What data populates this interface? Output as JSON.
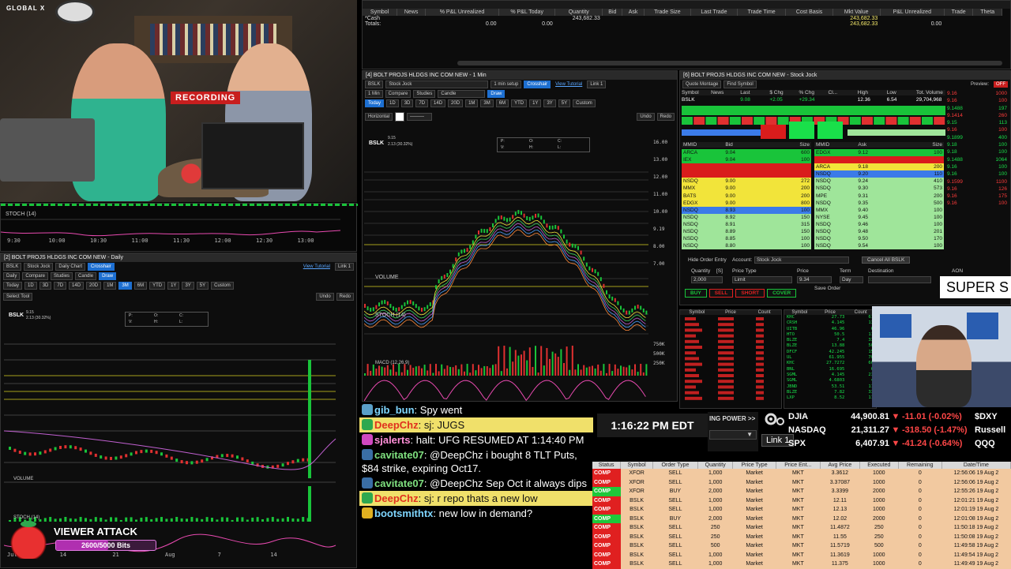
{
  "broadcast": {
    "logo": "GLOBAL X",
    "recording_label": "RECORDING",
    "super_text": "SUPER S",
    "clock": "1:16:22 PM EDT",
    "viewer_attack": {
      "title": "VIEWER ATTACK",
      "progress_text": "2600/5000 Bits",
      "progress": 0.52
    }
  },
  "positions": {
    "columns": [
      "Symbol",
      "News",
      "% P&L Unrealized",
      "% P&L Today",
      "Quantity",
      "Bid",
      "Ask",
      "Trade Size",
      "Last Trade",
      "Trade Time",
      "Cost Basis",
      "Mkt Value",
      "P&L Unrealized",
      "Trade",
      "Theta"
    ],
    "rows": [
      {
        "symbol": "*Cash",
        "quantity": "243,682.33",
        "mkt_value": "243,682.33"
      },
      {
        "symbol": "Totals:",
        "pnl_unreal_pct": "0.00",
        "pnl_today_pct": "0.00",
        "mkt_value": "243,682.33",
        "pnl_unreal": "0.00"
      }
    ]
  },
  "chart_intraday": {
    "title": "[4] BOLT PROJS HLDGS INC COM NEW - 1 Min",
    "symbol": "BSLK",
    "layout": "Stock Jock",
    "setup": "1 min setup",
    "crosshair": "Crosshair",
    "view_tutorial": "View Tutorial",
    "link": "Link 1",
    "interval": "1 Min",
    "compare": "Compare",
    "studies": "Studies",
    "style": "Candle",
    "draw": "Draw",
    "ranges": [
      "Today",
      "1D",
      "3D",
      "7D",
      "14D",
      "20D",
      "1M",
      "3M",
      "6M",
      "YTD",
      "1Y",
      "3Y",
      "5Y",
      "Custom"
    ],
    "active_range": "Today",
    "line_tool": "Horizontal",
    "undo": "Undo",
    "redo": "Redo",
    "quote": "BSLK",
    "price_time": "9.15",
    "change": "2.13 (30.32%)",
    "ohlc_labels": [
      "P:",
      "O:",
      "C:",
      "V:",
      "H:",
      "L:"
    ],
    "panes": [
      "VOLUME",
      "STOCH (14)",
      "MACD (12,26,9)"
    ],
    "price_ticks": [
      "16.00",
      "13.00",
      "12.00",
      "11.00",
      "10.00",
      "9.19",
      "8.00",
      "7.00"
    ],
    "vol_ticks": [
      "750K",
      "500K",
      "250K"
    ],
    "stoch_ticks": [
      "80",
      "50",
      "20"
    ]
  },
  "chart_daily": {
    "title": "[2] BOLT PROJS HLDGS INC COM NEW - Daily",
    "symbol": "BSLK",
    "layout": "Stock Jock",
    "chart_type": "Daily Chart",
    "crosshair": "Crosshair",
    "view_tutorial": "View Tutorial",
    "link": "Link 1",
    "interval": "Daily",
    "compare": "Compare",
    "studies": "Studies",
    "style": "Candle",
    "draw": "Draw",
    "ranges": [
      "Today",
      "1D",
      "3D",
      "7D",
      "14D",
      "20D",
      "1M",
      "3M",
      "6M",
      "YTD",
      "1Y",
      "3Y",
      "5Y",
      "Custom"
    ],
    "active_range": "3M",
    "select_tool": "Select Tool",
    "undo": "Undo",
    "redo": "Redo",
    "quote": "BSLK",
    "price_time": "9.15",
    "change": "2.13 (30.32%)",
    "ohlc_labels": [
      "P:",
      "O:",
      "C:",
      "V:",
      "H:",
      "L:"
    ],
    "panes": [
      "VOLUME",
      "STOCH (14)"
    ],
    "x_ticks": [
      "Jul",
      "14",
      "21",
      "Aug",
      "7",
      "14"
    ]
  },
  "stoch_top": {
    "label": "STOCH (14)",
    "x_ticks": [
      "9:30",
      "10:00",
      "10:30",
      "11:00",
      "11:30",
      "12:00",
      "12:30",
      "13:00"
    ]
  },
  "level2": {
    "title": "[6] BOLT PROJS HLDGS INC COM NEW - Stock Jock",
    "view": "Quote Montage",
    "find_symbol": "Find Symbol",
    "preview": "Preview:",
    "preview_state": "OFF",
    "quote_headers": [
      "Symbol",
      "News",
      "Last",
      "$ Chg",
      "% Chg",
      "Cl...",
      "High",
      "Low",
      "Tot. Volume"
    ],
    "quote": {
      "symbol": "BSLK",
      "last": "9.08",
      "chg": "+2.05",
      "pct": "+29.34",
      "high": "12.36",
      "low": "6.54",
      "volume": "29,704,968"
    },
    "bid_headers": [
      "MMID",
      "Bid",
      "Size"
    ],
    "ask_headers": [
      "MMID",
      "Ask",
      "Size"
    ],
    "bids": [
      {
        "mm": "ARCA",
        "px": "9.04",
        "sz": "600",
        "c": "#19c43a"
      },
      {
        "mm": "IEX",
        "px": "9.04",
        "sz": "100",
        "c": "#19c43a"
      },
      {
        "mm": "",
        "px": "",
        "sz": "",
        "c": "#d91c1c"
      },
      {
        "mm": "",
        "px": "",
        "sz": "",
        "c": "#d91c1c"
      },
      {
        "mm": "NSDQ",
        "px": "9.00",
        "sz": "272",
        "c": "#f2e43a"
      },
      {
        "mm": "MMX",
        "px": "9.00",
        "sz": "200",
        "c": "#f2e43a"
      },
      {
        "mm": "BATS",
        "px": "9.00",
        "sz": "200",
        "c": "#f2e43a"
      },
      {
        "mm": "EDGX",
        "px": "9.00",
        "sz": "800",
        "c": "#f2e43a"
      },
      {
        "mm": "NSDQ",
        "px": "8.93",
        "sz": "100",
        "c": "#3b7be8"
      },
      {
        "mm": "NSDQ",
        "px": "8.92",
        "sz": "150",
        "c": "#9fe59a"
      },
      {
        "mm": "NSDQ",
        "px": "8.91",
        "sz": "315",
        "c": "#9fe59a"
      },
      {
        "mm": "NSDQ",
        "px": "8.89",
        "sz": "150",
        "c": "#9fe59a"
      },
      {
        "mm": "NSDQ",
        "px": "8.85",
        "sz": "100",
        "c": "#9fe59a"
      },
      {
        "mm": "NSDQ",
        "px": "8.80",
        "sz": "100",
        "c": "#9fe59a"
      }
    ],
    "asks": [
      {
        "mm": "EDGX",
        "px": "9.12",
        "sz": "100",
        "c": "#19c43a"
      },
      {
        "mm": "",
        "px": "",
        "sz": "",
        "c": "#d91c1c"
      },
      {
        "mm": "ARCA",
        "px": "9.18",
        "sz": "200",
        "c": "#f2e43a"
      },
      {
        "mm": "NSDQ",
        "px": "9.20",
        "sz": "110",
        "c": "#3b7be8"
      },
      {
        "mm": "NSDQ",
        "px": "9.24",
        "sz": "410",
        "c": "#9fe59a"
      },
      {
        "mm": "NSDQ",
        "px": "9.30",
        "sz": "573",
        "c": "#9fe59a"
      },
      {
        "mm": "MPE",
        "px": "9.31",
        "sz": "200",
        "c": "#9fe59a"
      },
      {
        "mm": "NSDQ",
        "px": "9.35",
        "sz": "500",
        "c": "#9fe59a"
      },
      {
        "mm": "MMX",
        "px": "9.40",
        "sz": "100",
        "c": "#9fe59a"
      },
      {
        "mm": "NYSE",
        "px": "9.45",
        "sz": "100",
        "c": "#9fe59a"
      },
      {
        "mm": "NSDQ",
        "px": "9.46",
        "sz": "100",
        "c": "#9fe59a"
      },
      {
        "mm": "NSDQ",
        "px": "9.48",
        "sz": "201",
        "c": "#9fe59a"
      },
      {
        "mm": "NSDQ",
        "px": "9.50",
        "sz": "170",
        "c": "#9fe59a"
      },
      {
        "mm": "NSDQ",
        "px": "9.54",
        "sz": "100",
        "c": "#9fe59a"
      }
    ],
    "time_sales": [
      {
        "p": "9.16",
        "s": "1000",
        "c": "#ff3b3b"
      },
      {
        "p": "9.16",
        "s": "100",
        "c": "#ff3b3b"
      },
      {
        "p": "9.1488",
        "s": "197",
        "c": "#19e04a"
      },
      {
        "p": "9.1414",
        "s": "260",
        "c": "#ff3b3b"
      },
      {
        "p": "9.15",
        "s": "113",
        "c": "#19e04a"
      },
      {
        "p": "9.16",
        "s": "100",
        "c": "#ff3b3b"
      },
      {
        "p": "9.1899",
        "s": "400",
        "c": "#19e04a"
      },
      {
        "p": "9.18",
        "s": "100",
        "c": "#19e04a"
      },
      {
        "p": "9.18",
        "s": "100",
        "c": "#19e04a"
      },
      {
        "p": "9.1488",
        "s": "1064",
        "c": "#19e04a"
      },
      {
        "p": "9.16",
        "s": "100",
        "c": "#19e04a"
      },
      {
        "p": "9.16",
        "s": "100",
        "c": "#19e04a"
      },
      {
        "p": "9.1599",
        "s": "1100",
        "c": "#ff3b3b"
      },
      {
        "p": "9.16",
        "s": "126",
        "c": "#ff3b3b"
      },
      {
        "p": "9.16",
        "s": "175",
        "c": "#ff3b3b"
      },
      {
        "p": "9.16",
        "s": "100",
        "c": "#ff3b3b"
      }
    ],
    "order": {
      "hide_order_entry": "Hide Order Entry",
      "account_label": "Account:",
      "account": "Stock Jock",
      "cancel_all": "Cancel All BSLK",
      "qty_label": "Quantity",
      "qty_unit": "[S]",
      "price_type_label": "Price Type",
      "price_label": "Price",
      "term_label": "Term",
      "destination_label": "Destination",
      "aon": "AON",
      "qty": "2,000",
      "price_type": "Limit",
      "price": "9.34",
      "term": "Day",
      "save_order": "Save Order",
      "buttons": [
        "BUY",
        "SELL",
        "SHORT",
        "COVER"
      ]
    }
  },
  "scanners": {
    "headers": [
      "Symbol",
      "Price",
      "Count"
    ],
    "right_symbols": [
      "KHC",
      "CRSH",
      "UITB",
      "HTO",
      "BLZE",
      "BLZE",
      "DFCF",
      "UL",
      "KHC",
      "BNL",
      "SGML",
      "SGML",
      "JBND",
      "BLZE",
      "LXP"
    ],
    "right_prices": [
      "27.73",
      "4.145",
      "46.96",
      "50.5",
      "7.4",
      "13.88",
      "42.245",
      "61.955",
      "27.7272",
      "16.695",
      "4.145",
      "4.6803",
      "53.51",
      "7.82",
      "8.52"
    ],
    "right_counts": [
      "61",
      "13",
      "6",
      "11",
      "33",
      "50",
      "15",
      "70",
      "60",
      "6",
      "23",
      "4",
      "11",
      "33",
      "11"
    ]
  },
  "chat": [
    {
      "user": "gib_bun",
      "text": "Spy went",
      "color": "#7fd6ff",
      "hl": false,
      "icon": "#5aa0c8"
    },
    {
      "user": "DeepChz",
      "text": "sj: JUGS",
      "color": "#e0301e",
      "hl": true,
      "icon": "#2fa84f"
    },
    {
      "user": "sjalerts",
      "text": "halt: UFG RESUMED AT 1:14:40 PM",
      "color": "#ff8fd8",
      "hl": false,
      "icon": "#d048c0"
    },
    {
      "user": "cavitate07",
      "text": "@DeepChz i bought 8 TLT Puts, $84 strike, expiring Oct17.",
      "color": "#7fe07f",
      "hl": false,
      "icon": "#3a6ea5"
    },
    {
      "user": "cavitate07",
      "text": "@DeepChz Sep Oct it always dips",
      "color": "#7fe07f",
      "hl": false,
      "icon": "#3a6ea5"
    },
    {
      "user": "DeepChz",
      "text": "sj: r repo thats a new low",
      "color": "#e0301e",
      "hl": true,
      "icon": "#2fa84f"
    },
    {
      "user": "bootsmithtx",
      "text": "new low in demand?",
      "color": "#7fd6ff",
      "hl": false,
      "icon": "#e0b020"
    }
  ],
  "buying_power": {
    "label": "ING POWER >>",
    "link": "Link 1"
  },
  "market": [
    {
      "name": "DJIA",
      "value": "44,900.81",
      "chg": "-11.01 (-0.02%)",
      "sym": "$DXY"
    },
    {
      "name": "NASDAQ",
      "value": "21,311.27",
      "chg": "-318.50 (-1.47%)",
      "sym": "Russell"
    },
    {
      "name": "SPX",
      "value": "6,407.91",
      "chg": "-41.24 (-0.64%)",
      "sym": "QQQ"
    }
  ],
  "orders": {
    "columns": [
      "Status",
      "Symbol",
      "Order Type",
      "Quantity",
      "Price Type",
      "Price Ent...",
      "Avg Price",
      "Executed",
      "Remaining",
      "Date/Time"
    ],
    "rows": [
      {
        "st": "COMP",
        "sym": "XFOR",
        "type": "SELL",
        "qty": "1,000",
        "pt": "Market",
        "pe": "MKT",
        "avg": "3.3612",
        "ex": "1000",
        "rem": "0",
        "dt": "12:56:06 19 Aug 2",
        "c": "#e02020"
      },
      {
        "st": "COMP",
        "sym": "XFOR",
        "type": "SELL",
        "qty": "1,000",
        "pt": "Market",
        "pe": "MKT",
        "avg": "3.37087",
        "ex": "1000",
        "rem": "0",
        "dt": "12:56:06 19 Aug 2",
        "c": "#e02020"
      },
      {
        "st": "COMP",
        "sym": "XFOR",
        "type": "BUY",
        "qty": "2,000",
        "pt": "Market",
        "pe": "MKT",
        "avg": "3.3399",
        "ex": "2000",
        "rem": "0",
        "dt": "12:55:26 19 Aug 2",
        "c": "#1ec83a"
      },
      {
        "st": "COMP",
        "sym": "BSLK",
        "type": "SELL",
        "qty": "1,000",
        "pt": "Market",
        "pe": "MKT",
        "avg": "12.11",
        "ex": "1000",
        "rem": "0",
        "dt": "12:01:21 19 Aug 2",
        "c": "#e02020"
      },
      {
        "st": "COMP",
        "sym": "BSLK",
        "type": "SELL",
        "qty": "1,000",
        "pt": "Market",
        "pe": "MKT",
        "avg": "12.13",
        "ex": "1000",
        "rem": "0",
        "dt": "12:01:19 19 Aug 2",
        "c": "#e02020"
      },
      {
        "st": "COMP",
        "sym": "BSLK",
        "type": "BUY",
        "qty": "2,000",
        "pt": "Market",
        "pe": "MKT",
        "avg": "12.02",
        "ex": "2000",
        "rem": "0",
        "dt": "12:01:08 19 Aug 2",
        "c": "#1ec83a"
      },
      {
        "st": "COMP",
        "sym": "BSLK",
        "type": "SELL",
        "qty": "250",
        "pt": "Market",
        "pe": "MKT",
        "avg": "11.4872",
        "ex": "250",
        "rem": "0",
        "dt": "11:50:18 19 Aug 2",
        "c": "#e02020"
      },
      {
        "st": "COMP",
        "sym": "BSLK",
        "type": "SELL",
        "qty": "250",
        "pt": "Market",
        "pe": "MKT",
        "avg": "11.55",
        "ex": "250",
        "rem": "0",
        "dt": "11:50:08 19 Aug 2",
        "c": "#e02020"
      },
      {
        "st": "COMP",
        "sym": "BSLK",
        "type": "SELL",
        "qty": "500",
        "pt": "Market",
        "pe": "MKT",
        "avg": "11.5719",
        "ex": "500",
        "rem": "0",
        "dt": "11:49:58 19 Aug 2",
        "c": "#e02020"
      },
      {
        "st": "COMP",
        "sym": "BSLK",
        "type": "SELL",
        "qty": "1,000",
        "pt": "Market",
        "pe": "MKT",
        "avg": "11.3619",
        "ex": "1000",
        "rem": "0",
        "dt": "11:49:54 19 Aug 2",
        "c": "#e02020"
      },
      {
        "st": "COMP",
        "sym": "BSLK",
        "type": "SELL",
        "qty": "1,000",
        "pt": "Market",
        "pe": "MKT",
        "avg": "11.375",
        "ex": "1000",
        "rem": "0",
        "dt": "11:49:49 19 Aug 2",
        "c": "#e02020"
      }
    ]
  },
  "colors": {
    "accent": "#1d6fd1",
    "up": "#19c43a",
    "down": "#e02020",
    "highlight": "#f0e06a"
  }
}
